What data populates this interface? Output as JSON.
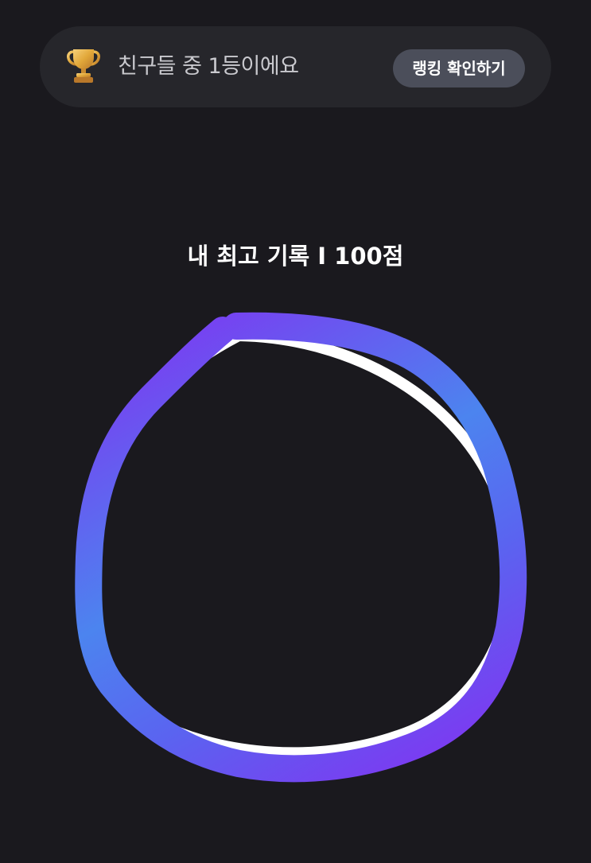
{
  "ranking_banner": {
    "icon": "trophy-icon",
    "message": "친구들 중 1등이에요",
    "button_label": "랭킹 확인하기"
  },
  "best_record": {
    "text": "내 최고 기록 I 100점"
  },
  "colors": {
    "background": "#1a191e",
    "banner_bg": "#26262b",
    "button_bg": "#4b4e5a",
    "stroke_purple": "#7b3df2",
    "stroke_blue": "#4a86f0",
    "trophy_gold": "#e2a83a"
  }
}
